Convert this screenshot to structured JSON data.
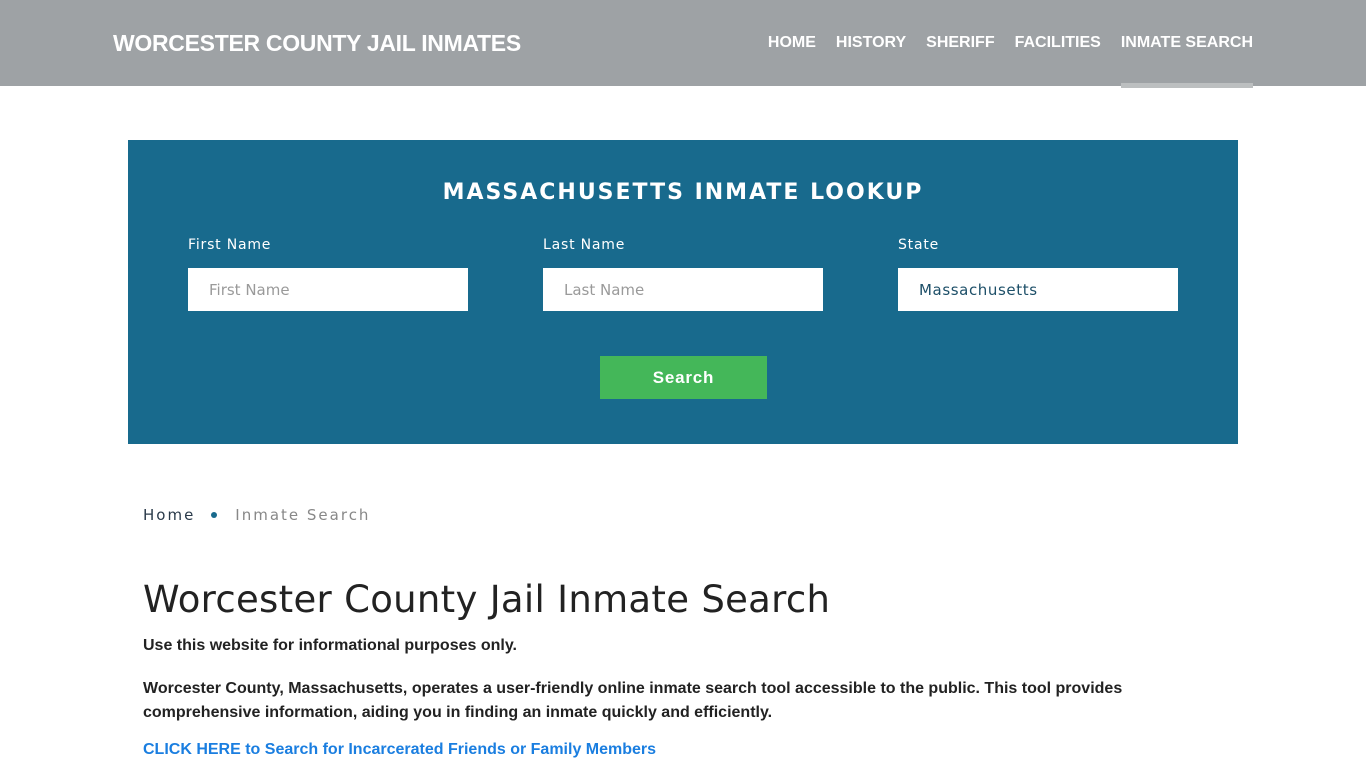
{
  "header": {
    "brand": "WORCESTER COUNTY JAIL INMATES",
    "nav": [
      {
        "label": "HOME",
        "active": false
      },
      {
        "label": "HISTORY",
        "active": false
      },
      {
        "label": "SHERIFF",
        "active": false
      },
      {
        "label": "FACILITIES",
        "active": false
      },
      {
        "label": "INMATE SEARCH",
        "active": true
      }
    ]
  },
  "search_panel": {
    "title": "MASSACHUSETTS INMATE LOOKUP",
    "first_name": {
      "label": "First Name",
      "placeholder": "First Name",
      "value": ""
    },
    "last_name": {
      "label": "Last Name",
      "placeholder": "Last Name",
      "value": ""
    },
    "state": {
      "label": "State",
      "value": "Massachusetts"
    },
    "search_button": "Search"
  },
  "breadcrumb": {
    "home": "Home",
    "current": "Inmate Search"
  },
  "content": {
    "title": "Worcester County Jail Inmate Search",
    "intro": "Use this website for informational purposes only.",
    "description": "Worcester County, Massachusetts, operates a user-friendly online inmate search tool accessible to the public. This tool provides comprehensive information, aiding you in finding an inmate quickly and efficiently.",
    "cta_link": "CLICK HERE to Search for Incarcerated Friends or Family Members"
  },
  "colors": {
    "header_bg": "#9ea2a5",
    "panel_bg": "#186a8d",
    "button_bg": "#44b759",
    "link": "#1a7ee0"
  }
}
